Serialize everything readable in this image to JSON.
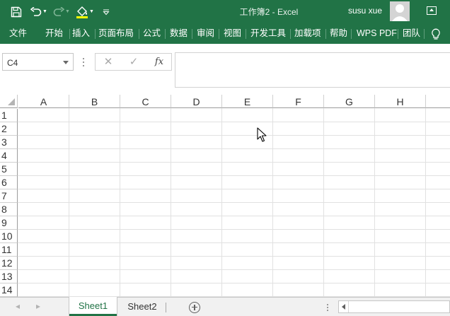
{
  "window": {
    "title": "工作簿2  -  Excel",
    "user": "susu xue"
  },
  "quick_access": {
    "icons": [
      "save-icon",
      "undo-icon",
      "redo-icon",
      "fill-color-icon",
      "customize-qat-icon"
    ],
    "fill_color": "#ffff00"
  },
  "ribbon": {
    "tabs": [
      "文件",
      "开始",
      "插入",
      "页面布局",
      "公式",
      "数据",
      "审阅",
      "视图",
      "开发工具",
      "加载项",
      "帮助",
      "WPS PDF",
      "团队"
    ],
    "tell_me_icon": "lightbulb-icon"
  },
  "formula_bar": {
    "name_box": "C4",
    "cancel_glyph": "✕",
    "enter_glyph": "✓",
    "fx_label": "fx",
    "formula": ""
  },
  "sheet": {
    "columns": [
      "A",
      "B",
      "C",
      "D",
      "E",
      "F",
      "G",
      "H"
    ],
    "rows": [
      "1",
      "2",
      "3",
      "4",
      "5",
      "6",
      "7",
      "8",
      "9",
      "10",
      "11",
      "12",
      "13",
      "14"
    ]
  },
  "sheet_tabs": {
    "nav_prev": "◂",
    "nav_next": "▸",
    "tabs": [
      "Sheet1",
      "Sheet2"
    ],
    "active": "Sheet1"
  },
  "colors": {
    "brand_green": "#217346",
    "gridline": "#e1e1e1"
  }
}
